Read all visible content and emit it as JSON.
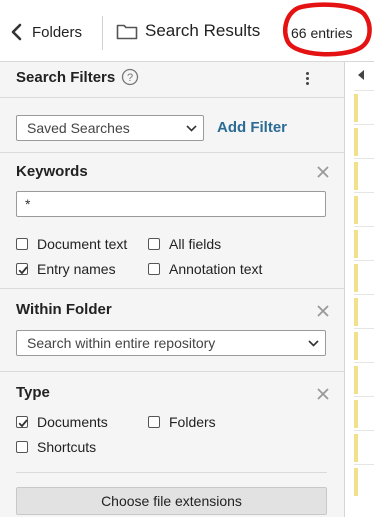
{
  "header": {
    "back_label": "Folders",
    "title": "Search Results",
    "entry_count": "66 entries"
  },
  "panel": {
    "title": "Search Filters",
    "saved_searches": {
      "selected": "Saved Searches"
    },
    "add_filter_label": "Add Filter",
    "keywords": {
      "title": "Keywords",
      "value": "*",
      "options": [
        {
          "label": "Document text",
          "checked": false
        },
        {
          "label": "All fields",
          "checked": false
        },
        {
          "label": "Entry names",
          "checked": true
        },
        {
          "label": "Annotation text",
          "checked": false
        }
      ]
    },
    "within_folder": {
      "title": "Within Folder",
      "selected": "Search within entire repository"
    },
    "type": {
      "title": "Type",
      "options": [
        {
          "label": "Documents",
          "checked": true
        },
        {
          "label": "Folders",
          "checked": false
        },
        {
          "label": "Shortcuts",
          "checked": false
        }
      ],
      "extensions_button": "Choose file extensions"
    }
  },
  "colors": {
    "accent_link": "#2b6b96",
    "annotation_red": "#e41212",
    "row_marker_yellow": "#f2e08a"
  }
}
